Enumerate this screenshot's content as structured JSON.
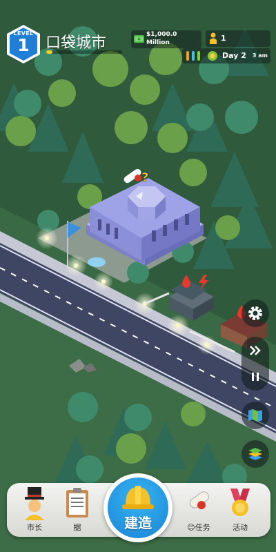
{
  "hud": {
    "level_label": "LEVEL",
    "level": "1",
    "city_name": "口袋城市",
    "money": "$1,000.0",
    "money_unit": "Million",
    "population": "1",
    "day": "Day 2",
    "time": "3 am"
  },
  "nav": {
    "mayor": "市长",
    "data": "据",
    "build": "建造",
    "tasks": "😊任务",
    "events": "活动"
  },
  "colors": {
    "level_badge": "#1f7fd6",
    "xp_bar": "#f6cf2a",
    "build_button": "#1f94e4",
    "road": "#3e4664",
    "grass": "#3d6d47"
  },
  "icons": {
    "money": "cash-icon",
    "population": "person-icon",
    "happiness": "bar-icons",
    "weather": "sun-icon",
    "settings": "gear-icon",
    "speed": "fast-forward-icon",
    "pause": "pause-icon",
    "map": "map-icon",
    "layers": "layers-icon"
  }
}
